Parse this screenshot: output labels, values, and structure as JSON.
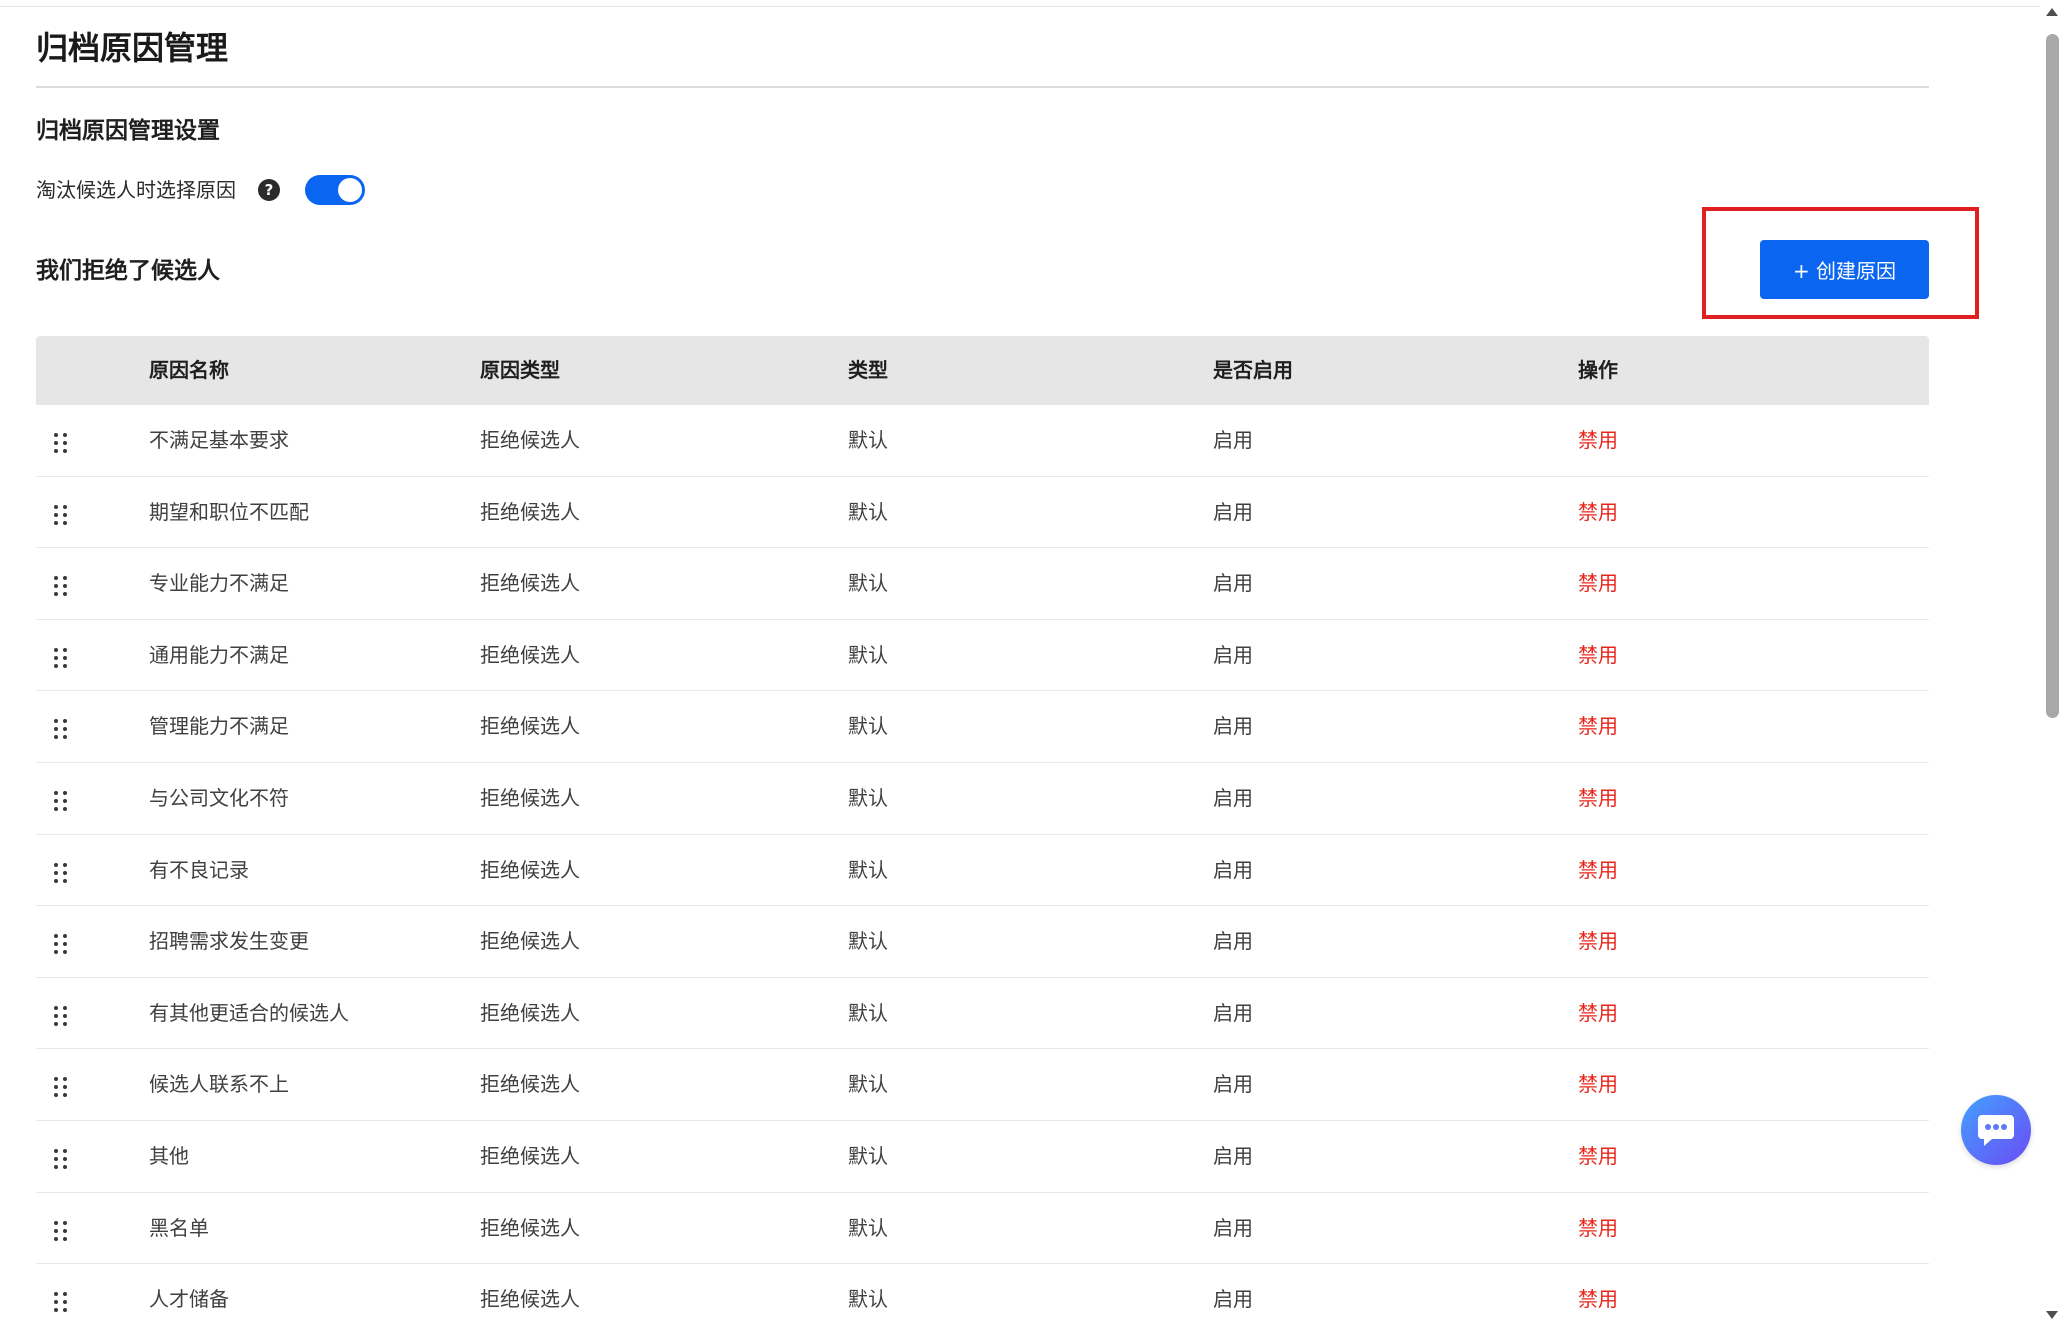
{
  "page": {
    "title": "归档原因管理"
  },
  "settings": {
    "section_title": "归档原因管理设置",
    "toggle_label": "淘汰候选人时选择原因",
    "toggle_on": true
  },
  "rejected_section": {
    "title": "我们拒绝了候选人",
    "create_button_label": "+ 创建原因"
  },
  "table": {
    "headers": {
      "name": "原因名称",
      "reason_type": "原因类型",
      "type": "类型",
      "enabled": "是否启用",
      "action": "操作"
    },
    "rows": [
      {
        "name": "不满足基本要求",
        "reason_type": "拒绝候选人",
        "type": "默认",
        "enabled": "启用",
        "action": "禁用"
      },
      {
        "name": "期望和职位不匹配",
        "reason_type": "拒绝候选人",
        "type": "默认",
        "enabled": "启用",
        "action": "禁用"
      },
      {
        "name": "专业能力不满足",
        "reason_type": "拒绝候选人",
        "type": "默认",
        "enabled": "启用",
        "action": "禁用"
      },
      {
        "name": "通用能力不满足",
        "reason_type": "拒绝候选人",
        "type": "默认",
        "enabled": "启用",
        "action": "禁用"
      },
      {
        "name": "管理能力不满足",
        "reason_type": "拒绝候选人",
        "type": "默认",
        "enabled": "启用",
        "action": "禁用"
      },
      {
        "name": "与公司文化不符",
        "reason_type": "拒绝候选人",
        "type": "默认",
        "enabled": "启用",
        "action": "禁用"
      },
      {
        "name": "有不良记录",
        "reason_type": "拒绝候选人",
        "type": "默认",
        "enabled": "启用",
        "action": "禁用"
      },
      {
        "name": "招聘需求发生变更",
        "reason_type": "拒绝候选人",
        "type": "默认",
        "enabled": "启用",
        "action": "禁用"
      },
      {
        "name": "有其他更适合的候选人",
        "reason_type": "拒绝候选人",
        "type": "默认",
        "enabled": "启用",
        "action": "禁用"
      },
      {
        "name": "候选人联系不上",
        "reason_type": "拒绝候选人",
        "type": "默认",
        "enabled": "启用",
        "action": "禁用"
      },
      {
        "name": "其他",
        "reason_type": "拒绝候选人",
        "type": "默认",
        "enabled": "启用",
        "action": "禁用"
      },
      {
        "name": "黑名单",
        "reason_type": "拒绝候选人",
        "type": "默认",
        "enabled": "启用",
        "action": "禁用"
      },
      {
        "name": "人才储备",
        "reason_type": "拒绝候选人",
        "type": "默认",
        "enabled": "启用",
        "action": "禁用"
      }
    ]
  },
  "colors": {
    "primary": "#0a66f0",
    "danger": "#e8261c",
    "highlight": "#e02020",
    "header_bg": "#e6e6e6"
  },
  "icons": {
    "help": "question-circle-icon",
    "drag": "drag-handle-icon",
    "chat": "chat-bubble-icon"
  }
}
